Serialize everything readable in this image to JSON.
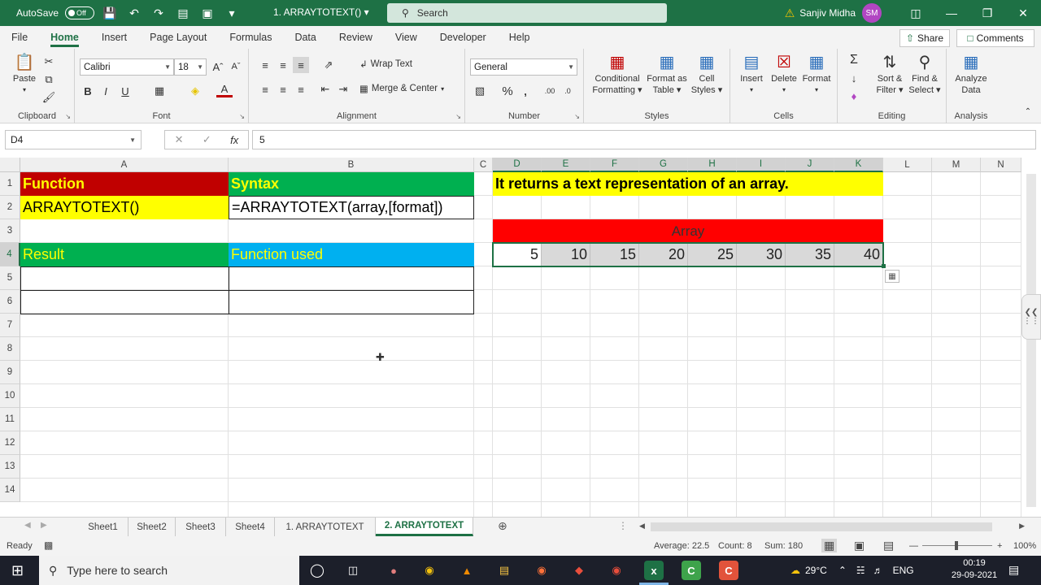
{
  "titlebar": {
    "autosave_label": "AutoSave",
    "autosave_state": "Off",
    "doc_title": "1. ARRAYTOTEXT()",
    "search_placeholder": "Search",
    "user_name": "Sanjiv Midha",
    "user_initials": "SM"
  },
  "ribbon_tabs": [
    "File",
    "Home",
    "Insert",
    "Page Layout",
    "Formulas",
    "Data",
    "Review",
    "View",
    "Developer",
    "Help"
  ],
  "share_label": "Share",
  "comments_label": "Comments",
  "ribbon": {
    "clipboard": {
      "label": "Clipboard",
      "paste": "Paste"
    },
    "font": {
      "label": "Font",
      "name": "Calibri",
      "size": "18"
    },
    "alignment": {
      "label": "Alignment",
      "wrap": "Wrap Text",
      "merge": "Merge & Center"
    },
    "number": {
      "label": "Number",
      "format": "General"
    },
    "styles": {
      "label": "Styles",
      "cond1": "Conditional",
      "cond2": "Formatting",
      "fmt1": "Format as",
      "fmt2": "Table",
      "cell1": "Cell",
      "cell2": "Styles"
    },
    "cells": {
      "label": "Cells",
      "insert": "Insert",
      "delete": "Delete",
      "format": "Format"
    },
    "editing": {
      "label": "Editing",
      "sort1": "Sort &",
      "sort2": "Filter",
      "find1": "Find &",
      "find2": "Select"
    },
    "analysis": {
      "label": "Analysis",
      "an1": "Analyze",
      "an2": "Data"
    }
  },
  "formula_bar": {
    "name_box": "D4",
    "fx": "fx",
    "value": "5"
  },
  "columns": [
    "A",
    "B",
    "C",
    "D",
    "E",
    "F",
    "G",
    "H",
    "I",
    "J",
    "K",
    "L",
    "M",
    "N"
  ],
  "rows": [
    "1",
    "2",
    "3",
    "4",
    "5",
    "6",
    "7",
    "8",
    "9",
    "10",
    "11",
    "12",
    "13",
    "14"
  ],
  "cells": {
    "a1": "Function",
    "b1": "Syntax",
    "a2": "ARRAYTOTEXT()",
    "b2": "=ARRAYTOTEXT(array,[format])",
    "a4": "Result",
    "b4": "Function used",
    "d1": "It returns a text representation of an array.",
    "d3": "Array",
    "array_values": [
      "5",
      "10",
      "15",
      "20",
      "25",
      "30",
      "35",
      "40"
    ]
  },
  "colors": {
    "excel_green": "#1e7145",
    "header_red": "#c00000",
    "header_green": "#00b050",
    "yellow": "#ffff00",
    "cyan_blue": "#00b0f0",
    "array_red": "#ff0000",
    "array_grey": "#d9d9d9"
  },
  "sheets": [
    "Sheet1",
    "Sheet2",
    "Sheet3",
    "Sheet4",
    "1. ARRAYTOTEXT",
    "2. ARRAYTOTEXT"
  ],
  "status": {
    "ready": "Ready",
    "average": "Average: 22.5",
    "count": "Count: 8",
    "sum": "Sum: 180",
    "zoom": "100%"
  },
  "taskbar": {
    "search_placeholder": "Type here to search",
    "temperature": "29°C",
    "language": "ENG",
    "time": "00:19",
    "date": "29-09-2021"
  }
}
